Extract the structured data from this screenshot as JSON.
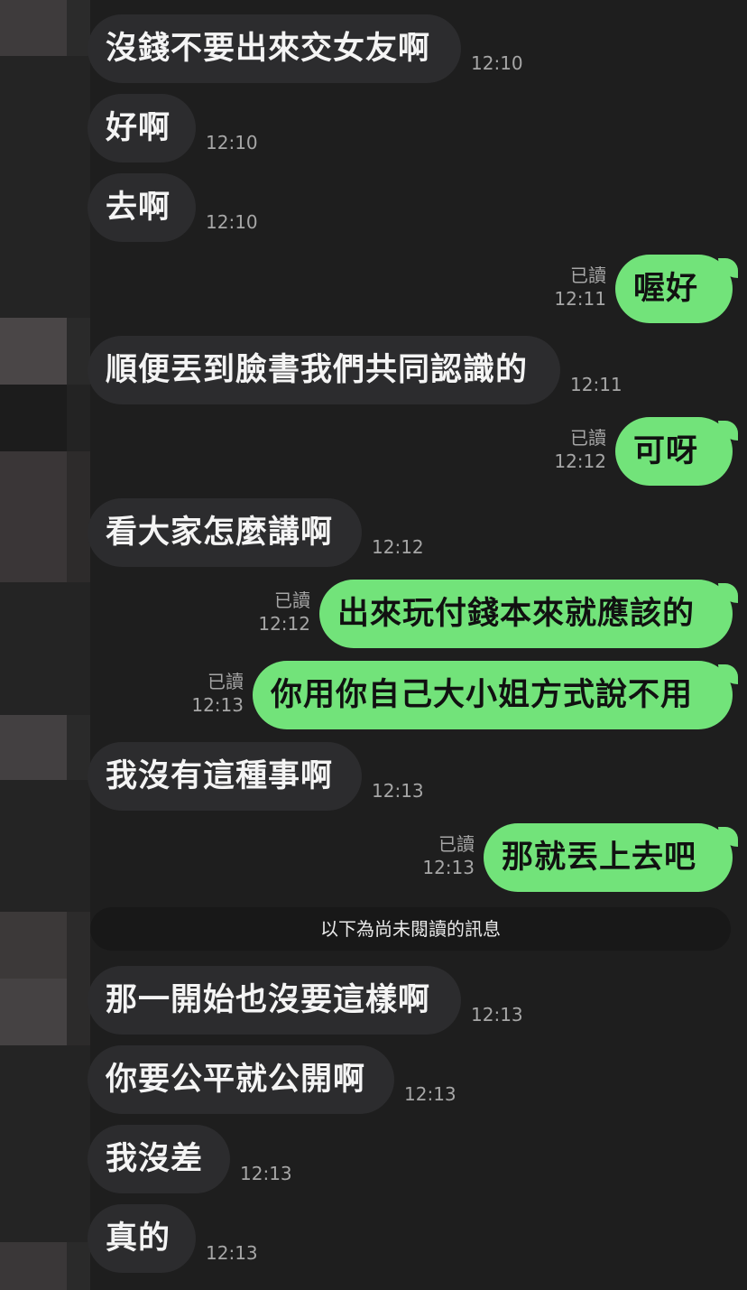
{
  "chat": {
    "divider": "以下為尚未閱讀的訊息",
    "read_label": "已讀",
    "messages": [
      {
        "dir": "in",
        "text": "沒錢不要出來交女友啊",
        "time": "12:10"
      },
      {
        "dir": "in",
        "text": "好啊",
        "time": "12:10"
      },
      {
        "dir": "in",
        "text": "去啊",
        "time": "12:10"
      },
      {
        "dir": "out",
        "text": "喔好",
        "time": "12:11",
        "read": "已讀"
      },
      {
        "dir": "in",
        "text": "順便丟到臉書我們共同認識的",
        "time": "12:11"
      },
      {
        "dir": "out",
        "text": "可呀",
        "time": "12:12",
        "read": "已讀"
      },
      {
        "dir": "in",
        "text": "看大家怎麼講啊",
        "time": "12:12"
      },
      {
        "dir": "out",
        "text": "出來玩付錢本來就應該的",
        "time": "12:12",
        "read": "已讀"
      },
      {
        "dir": "out",
        "text": "你用你自己大小姐方式說不用",
        "time": "12:13",
        "read": "已讀"
      },
      {
        "dir": "in",
        "text": "我沒有這種事啊",
        "time": "12:13"
      },
      {
        "dir": "out",
        "text": "那就丟上去吧",
        "time": "12:13",
        "read": "已讀"
      },
      {
        "dir": "in",
        "text": "那一開始也沒要這樣啊",
        "time": "12:13"
      },
      {
        "dir": "in",
        "text": "你要公平就公開啊",
        "time": "12:13"
      },
      {
        "dir": "in",
        "text": "我沒差",
        "time": "12:13"
      },
      {
        "dir": "in",
        "text": "真的",
        "time": "12:13"
      }
    ]
  },
  "colors": {
    "background": "#1e1e1e",
    "incoming_bubble": "#2c2c2e",
    "outgoing_bubble": "#72e37a",
    "timestamp": "#a6a6a6"
  }
}
